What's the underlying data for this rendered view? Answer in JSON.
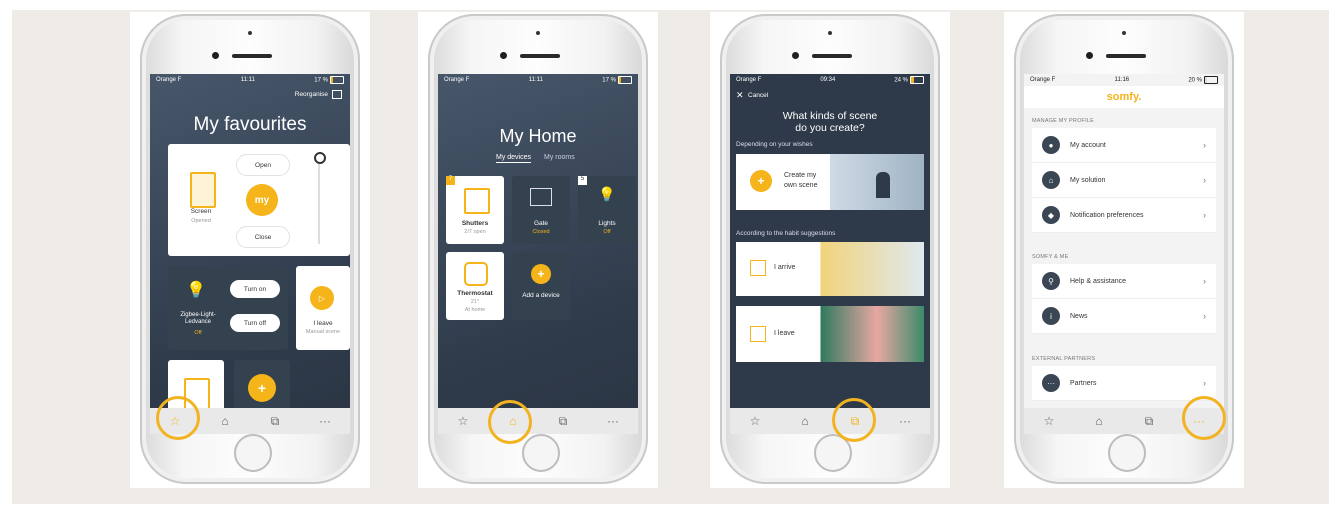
{
  "phones": [
    {
      "status": {
        "carrier": "Orange F",
        "time": "11:11",
        "battery": "17 %"
      },
      "header": {
        "reorganise": "Reorganise",
        "title": "My favourites"
      },
      "screen_card": {
        "name": "Screen",
        "state": "Opened",
        "open": "Open",
        "my": "my",
        "close": "Close"
      },
      "light_card": {
        "name": "Zigbee-Light-Ledvance",
        "state": "Off",
        "on": "Turn on",
        "off": "Turn off"
      },
      "scene_card": {
        "name": "I leave",
        "sub": "Manual scene"
      },
      "add_label": "+",
      "nav": [
        "☆",
        "⌂",
        "⧉",
        "···"
      ]
    },
    {
      "status": {
        "carrier": "Orange F",
        "time": "11:11",
        "battery": "17 %"
      },
      "header": {
        "title": "My Home",
        "tab1": "My devices",
        "tab2": "My rooms"
      },
      "devices": [
        {
          "badge": "7",
          "name": "Shutters",
          "state": "2/7 open"
        },
        {
          "name": "Gate",
          "state": "Closed"
        },
        {
          "badge": "5",
          "name": "Lights",
          "state": "Off"
        },
        {
          "name": "Thermostat",
          "state": "21°",
          "sub": "At home"
        },
        {
          "name": "Add a device"
        }
      ],
      "nav": [
        "☆",
        "⌂",
        "⧉",
        "···"
      ]
    },
    {
      "status": {
        "carrier": "Orange F",
        "time": "09:34",
        "battery": "24 %"
      },
      "cancel": "Cancel",
      "title1": "What kinds of scene",
      "title2": "do you create?",
      "section1": "Depending on your wishes",
      "create1": "Create my",
      "create2": "own scene",
      "section2": "According to the habit suggestions",
      "arrive": "I arrive",
      "leave": "I leave",
      "nav": [
        "☆",
        "⌂",
        "⧉",
        "···"
      ]
    },
    {
      "status": {
        "carrier": "Orange F",
        "time": "11:16",
        "battery": "20 %"
      },
      "brand": "somfy.",
      "sec1": "MANAGE MY PROFILE",
      "sec1_items": [
        "My account",
        "My solution",
        "Notification preferences"
      ],
      "sec2": "SOMFY & ME",
      "sec2_items": [
        "Help & assistance",
        "News"
      ],
      "sec3": "EXTERNAL PARTNERS",
      "sec3_items": [
        "Partners"
      ],
      "nav": [
        "☆",
        "⌂",
        "⧉",
        "···"
      ]
    }
  ]
}
